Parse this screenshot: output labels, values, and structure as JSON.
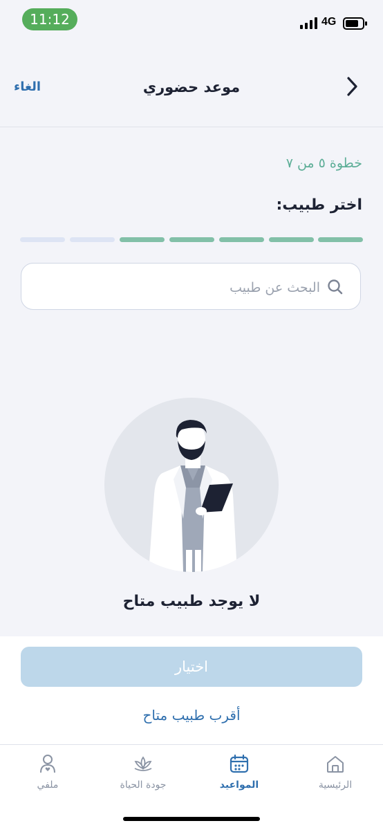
{
  "status_bar": {
    "time": "11:12",
    "network": "4G",
    "accent_color": "#55ad5b"
  },
  "header": {
    "title": "موعد حضوري",
    "cancel_label": "الغاء",
    "back_icon": "chevron-right-icon"
  },
  "wizard": {
    "step_text": "خطوة ٥ من ٧",
    "heading": "اختر طبيب:",
    "current_step": 5,
    "total_steps": 7
  },
  "search": {
    "placeholder": "البحث عن طبيب",
    "value": "",
    "icon": "search-icon"
  },
  "empty_state": {
    "illustration": "doctor-illustration",
    "message": "لا يوجد طبيب متاح"
  },
  "actions": {
    "select_label": "اختيار",
    "nearest_doctor_label": "أقرب طبيب متاح"
  },
  "tab_bar": {
    "tabs": [
      {
        "label": "الرئيسية",
        "icon": "home-icon",
        "active": false
      },
      {
        "label": "المواعيد",
        "icon": "calendar-icon",
        "active": true
      },
      {
        "label": "جودة الحياة",
        "icon": "lotus-icon",
        "active": false
      },
      {
        "label": "ملفي",
        "icon": "profile-icon",
        "active": false
      }
    ]
  },
  "colors": {
    "primary": "#2f6fae",
    "progress_done": "#82c0a8",
    "progress_pending": "#dde4f4",
    "button_disabled": "#bdd7ea",
    "step_text": "#5dae97"
  }
}
